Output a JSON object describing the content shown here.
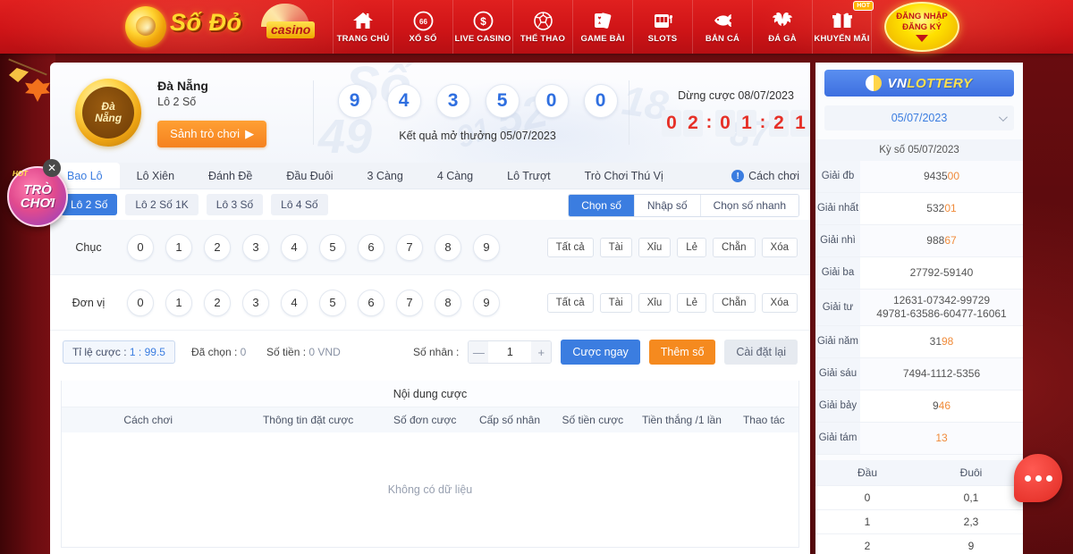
{
  "topnav": {
    "logo": {
      "brand": "Số Đỏ",
      "badge": "casino"
    },
    "items": [
      {
        "label": "TRANG CHỦ",
        "icon": "home-icon"
      },
      {
        "label": "XỔ SỐ",
        "icon": "lottery-66-icon"
      },
      {
        "label": "LIVE CASINO",
        "icon": "dollar-coin-icon"
      },
      {
        "label": "THỂ THAO",
        "icon": "soccer-ball-icon"
      },
      {
        "label": "GAME BÀI",
        "icon": "playing-cards-icon"
      },
      {
        "label": "SLOTS",
        "icon": "slot-machine-icon"
      },
      {
        "label": "BẮN CÁ",
        "icon": "fish-icon"
      },
      {
        "label": "ĐÁ GÀ",
        "icon": "rooster-fight-icon"
      },
      {
        "label": "KHUYẾN MÃI",
        "icon": "gift-box-icon",
        "badge": "HOT"
      }
    ],
    "login": {
      "line1": "ĐĂNG NHẬP",
      "line2": "ĐĂNG KÝ"
    }
  },
  "floating": {
    "trochoi": {
      "hot": "HOT",
      "line1": "TRÒ",
      "line2": "CHƠI"
    },
    "close": "✕"
  },
  "game_header": {
    "coin_line1": "Đà",
    "coin_line2": "Nẵng",
    "name": "Đà Nẵng",
    "subtitle": "Lô 2 Số",
    "lobby_button": "Sảnh trò chơi",
    "lobby_arrow": "▶",
    "result_balls": [
      "9",
      "4",
      "3",
      "5",
      "0",
      "0"
    ],
    "result_text": "Kết quả mở thưởng 05/07/2023",
    "timer_label": "Dừng cược 08/07/2023",
    "timer_digits": [
      "0",
      "2",
      "0",
      "1",
      "2",
      "1"
    ],
    "timer_sep": ":",
    "watermarks": [
      "Số",
      "52",
      "49",
      "18",
      "87",
      "91"
    ]
  },
  "tabs": {
    "items": [
      "Bao Lô",
      "Lô Xiên",
      "Đánh Đề",
      "Đầu Đuôi",
      "3 Càng",
      "4 Càng",
      "Lô Trượt",
      "Trò Chơi Thú Vị"
    ],
    "active_index": 0,
    "howto": "Cách chơi",
    "howto_icon": "info-icon"
  },
  "subtabs": {
    "chips": [
      "Lô 2 Số",
      "Lô 2 Số 1K",
      "Lô 3 Số",
      "Lô 4 Số"
    ],
    "active_index": 0,
    "modes": [
      "Chọn số",
      "Nhập số",
      "Chọn số nhanh"
    ],
    "mode_active_index": 0
  },
  "number_rows": [
    {
      "label": "Chục",
      "numbers": [
        "0",
        "1",
        "2",
        "3",
        "4",
        "5",
        "6",
        "7",
        "8",
        "9"
      ],
      "quick": [
        "Tất cả",
        "Tài",
        "Xỉu",
        "Lẻ",
        "Chẵn",
        "Xóa"
      ]
    },
    {
      "label": "Đơn vị",
      "numbers": [
        "0",
        "1",
        "2",
        "3",
        "4",
        "5",
        "6",
        "7",
        "8",
        "9"
      ],
      "quick": [
        "Tất cả",
        "Tài",
        "Xỉu",
        "Lẻ",
        "Chẵn",
        "Xóa"
      ]
    }
  ],
  "betbar": {
    "odds_prefix": "Tỉ lệ cược : ",
    "odds_value": "1 : 99.5",
    "selected_label": "Đã chọn : ",
    "selected_value": "0",
    "amount_label": "Số tiền : ",
    "amount_value": "0 VND",
    "multiplier_label": "Số nhân :",
    "minus": "—",
    "plus": "+",
    "multiplier_value": "1",
    "bet_now": "Cược ngay",
    "add_number": "Thêm số",
    "reset": "Cài đặt lại"
  },
  "content": {
    "title": "Nội dung cược",
    "columns": [
      "Cách chơi",
      "Thông tin đặt cược",
      "Số đơn cược",
      "Cấp số nhân",
      "Số tiền cược",
      "Tiền thắng /1 lần",
      "Thao tác"
    ],
    "empty": "Không có dữ liệu"
  },
  "sidebar": {
    "logo_text": "VN",
    "logo_text2": "LOTTERY",
    "date": "05/07/2023",
    "period_label": "Kỳ số 05/07/2023",
    "prizes": [
      {
        "name": "Giải đb",
        "plain": "9435",
        "hi": "00"
      },
      {
        "name": "Giải nhất",
        "plain": "532",
        "hi": "01"
      },
      {
        "name": "Giải nhì",
        "plain": "988",
        "hi": "67"
      },
      {
        "name": "Giải ba",
        "line1": "27792-59140"
      },
      {
        "name": "Giải tư",
        "line1": "12631-07342-99729",
        "line2": "49781-63586-60477-16061"
      },
      {
        "name": "Giải năm",
        "plain": "31",
        "hi": "98"
      },
      {
        "name": "Giải sáu",
        "line1": "7494-1112-5356"
      },
      {
        "name": "Giải bảy",
        "plain": "9",
        "hi": "46"
      },
      {
        "name": "Giải tám",
        "plain": "",
        "hi": "13"
      }
    ],
    "dt_headers": [
      "Đầu",
      "Đuôi"
    ],
    "dt_rows": [
      {
        "dau": "0",
        "duoi": "0,1"
      },
      {
        "dau": "1",
        "duoi": "2,3"
      },
      {
        "dau": "2",
        "duoi": "9"
      }
    ]
  },
  "chat": {
    "icon": "chat-dots-icon"
  },
  "colors": {
    "brand_red": "#cf1417",
    "accent_blue": "#3b7de0",
    "accent_orange": "#f58a1f",
    "timer_red": "#e63027",
    "prize_highlight": "#f08b3a"
  }
}
